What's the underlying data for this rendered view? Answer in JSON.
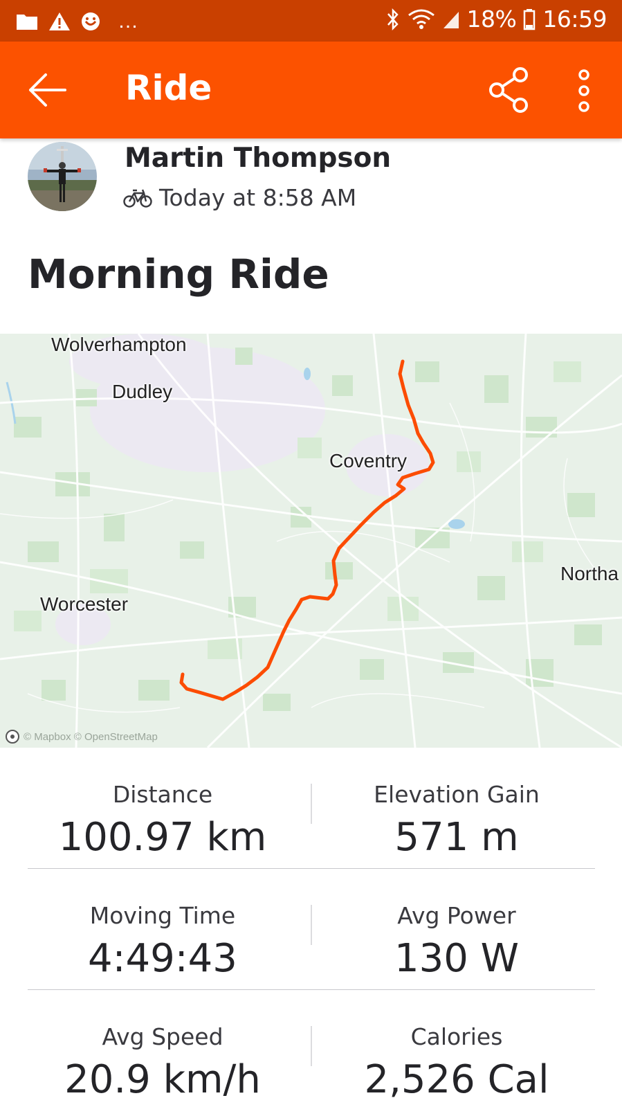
{
  "status_bar": {
    "battery_percent": "18%",
    "time": "16:59",
    "more_notifications": "…",
    "icons": [
      "folder-icon",
      "warning-icon",
      "smiley-icon",
      "bluetooth-icon",
      "wifi-icon",
      "signal-icon",
      "battery-icon"
    ]
  },
  "app_bar": {
    "title": "Ride",
    "icons": [
      "back-arrow-icon",
      "share-icon",
      "more-vert-icon"
    ]
  },
  "activity": {
    "athlete_name": "Martin Thompson",
    "timestamp": "Today at 8:58 AM",
    "sport_icon": "bike-icon",
    "title": "Morning Ride"
  },
  "map": {
    "labels": {
      "wolverhampton": "Wolverhampton",
      "dudley": "Dudley",
      "coventry": "Coventry",
      "worcester": "Worcester",
      "north": "Northa"
    },
    "attribution": "© Mapbox © OpenStreetMap",
    "route_color": "#fc4c02"
  },
  "stats": [
    {
      "left": {
        "label": "Distance",
        "value": "100.97 km"
      },
      "right": {
        "label": "Elevation Gain",
        "value": "571 m"
      }
    },
    {
      "left": {
        "label": "Moving Time",
        "value": "4:49:43"
      },
      "right": {
        "label": "Avg Power",
        "value": "130 W"
      }
    },
    {
      "left": {
        "label": "Avg Speed",
        "value": "20.9 km/h"
      },
      "right": {
        "label": "Calories",
        "value": "2,526 Cal"
      }
    }
  ],
  "colors": {
    "brand_orange": "#fc5200",
    "status_bar": "#c94000",
    "text_primary": "#242428"
  }
}
